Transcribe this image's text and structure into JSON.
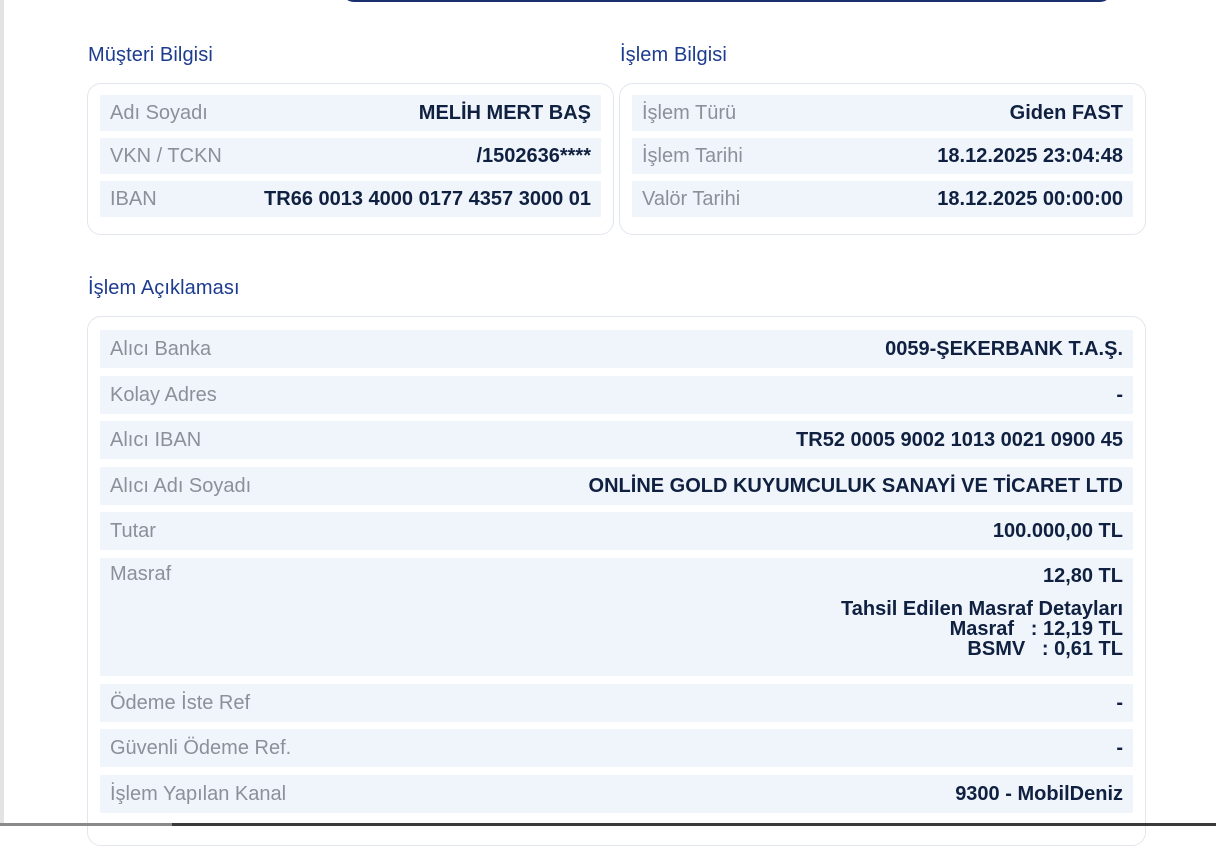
{
  "customer": {
    "title": "Müşteri Bilgisi",
    "rows": [
      {
        "label": "Adı Soyadı",
        "value": "MELİH MERT BAŞ"
      },
      {
        "label": "VKN / TCKN",
        "value": "/1502636****"
      },
      {
        "label": "IBAN",
        "value": "TR66 0013 4000 0177 4357 3000 01"
      }
    ]
  },
  "transaction": {
    "title": "İşlem Bilgisi",
    "rows": [
      {
        "label": "İşlem Türü",
        "value": "Giden FAST"
      },
      {
        "label": "İşlem Tarihi",
        "value": "18.12.2025 23:04:48"
      },
      {
        "label": "Valör Tarihi",
        "value": "18.12.2025 00:00:00"
      }
    ]
  },
  "description": {
    "title": "İşlem Açıklaması",
    "rows": [
      {
        "label": "Alıcı Banka",
        "value": "0059-ŞEKERBANK T.A.Ş."
      },
      {
        "label": "Kolay Adres",
        "value": "-"
      },
      {
        "label": "Alıcı IBAN",
        "value": "TR52 0005 9002 1013 0021 0900 45"
      },
      {
        "label": "Alıcı Adı Soyadı",
        "value": "ONLİNE GOLD KUYUMCULUK SANAYİ VE TİCARET LTD"
      },
      {
        "label": "Tutar",
        "value": "100.000,00 TL"
      }
    ],
    "fee": {
      "label": "Masraf",
      "value": "12,80 TL",
      "details_title": "Tahsil Edilen Masraf Detayları",
      "details_line1": "Masraf   : 12,19 TL",
      "details_line2": "BSMV   : 0,61 TL"
    },
    "rows_after": [
      {
        "label": "Ödeme İste Ref",
        "value": "-"
      },
      {
        "label": "Güvenli Ödeme Ref.",
        "value": "-"
      },
      {
        "label": "İşlem Yapılan Kanal",
        "value": "9300 - MobilDeniz"
      }
    ]
  }
}
